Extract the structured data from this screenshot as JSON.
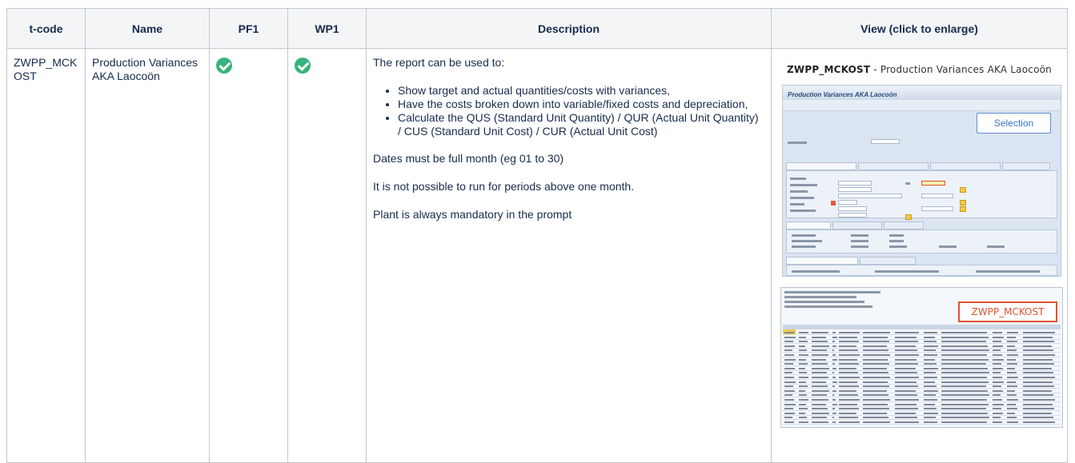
{
  "headers": {
    "tcode": "t-code",
    "name": "Name",
    "pf1": "PF1",
    "wp1": "WP1",
    "description": "Description",
    "view": "View (click to enlarge)"
  },
  "row": {
    "tcode": "ZWPP_MCKOST",
    "name": "Production Variances AKA Laocoön",
    "pf1_status": "check",
    "wp1_status": "check",
    "description": {
      "intro": "The report can be used to:",
      "bullets": [
        "Show target and actual quantities/costs with variances,",
        "Have the costs broken down into variable/fixed costs and depreciation,",
        "Calculate the QUS (Standard Unit Quantity) / QUR (Actual Unit Quantity) / CUS (Standard Unit Cost) / CUR (Actual Unit Cost)"
      ],
      "note1": "Dates must be full month (eg 01 to 30)",
      "note2": "It is not possible to run for periods above one month.",
      "note3": "Plant is always mandatory in the prompt"
    },
    "view": {
      "title_code": "ZWPP_MCKOST",
      "title_rest": " - Production Variances AKA Laocoön",
      "screen_header": "Production Variances AKA Laocoön",
      "selection_button": "Selection",
      "result_label": "ZWPP_MCKOST"
    }
  },
  "colors": {
    "check": "#36b37e",
    "header_bg": "#f4f5f7",
    "border": "#c1c7d0",
    "highlight_red": "#e0502e",
    "sap_blue": "#3a78c8"
  }
}
